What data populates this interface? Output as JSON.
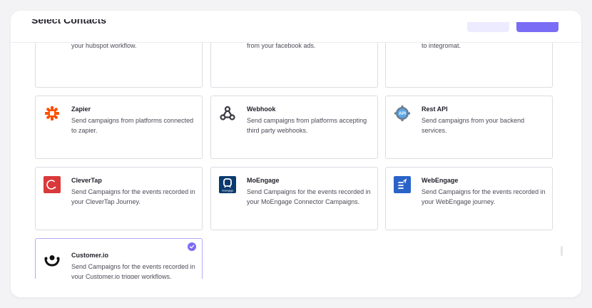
{
  "header": {
    "title": "Select Contacts"
  },
  "partial_row": [
    {
      "desc": "your hubspot workflow."
    },
    {
      "desc": "from your facebook ads."
    },
    {
      "desc": "to integromat."
    }
  ],
  "cards": [
    {
      "name": "Zapier",
      "desc": "Send campaigns from platforms connected to zapier.",
      "icon": "zapier-icon"
    },
    {
      "name": "Webhook",
      "desc": "Send campaigns from platforms accepting third party webhooks.",
      "icon": "webhook-icon"
    },
    {
      "name": "Rest API",
      "desc": "Send campaigns from your backend services.",
      "icon": "rest-api-icon"
    },
    {
      "name": "CleverTap",
      "desc": "Send Campaigns for the events recorded in your CleverTap Journey.",
      "icon": "clevertap-icon"
    },
    {
      "name": "MoEngage",
      "desc": "Send Campaigns for the events recorded in your MoEngage Connector Campaigns.",
      "icon": "moengage-icon",
      "icon_text": "moengage"
    },
    {
      "name": "WebEngage",
      "desc": "Send Campaigns for the events recorded in your WebEngage journey.",
      "icon": "webengage-icon"
    },
    {
      "name": "Customer.io",
      "desc": "Send Campaigns for the events recorded in your Customer.io trigger workflows.",
      "icon": "customerio-icon",
      "selected": true
    }
  ],
  "colors": {
    "accent": "#7b6cf6",
    "accent_light": "#ecebff",
    "zapier": "#ff4f00",
    "clevertap": "#d9393b",
    "moengage": "#0b3a6e",
    "webengage": "#2a63c8"
  }
}
